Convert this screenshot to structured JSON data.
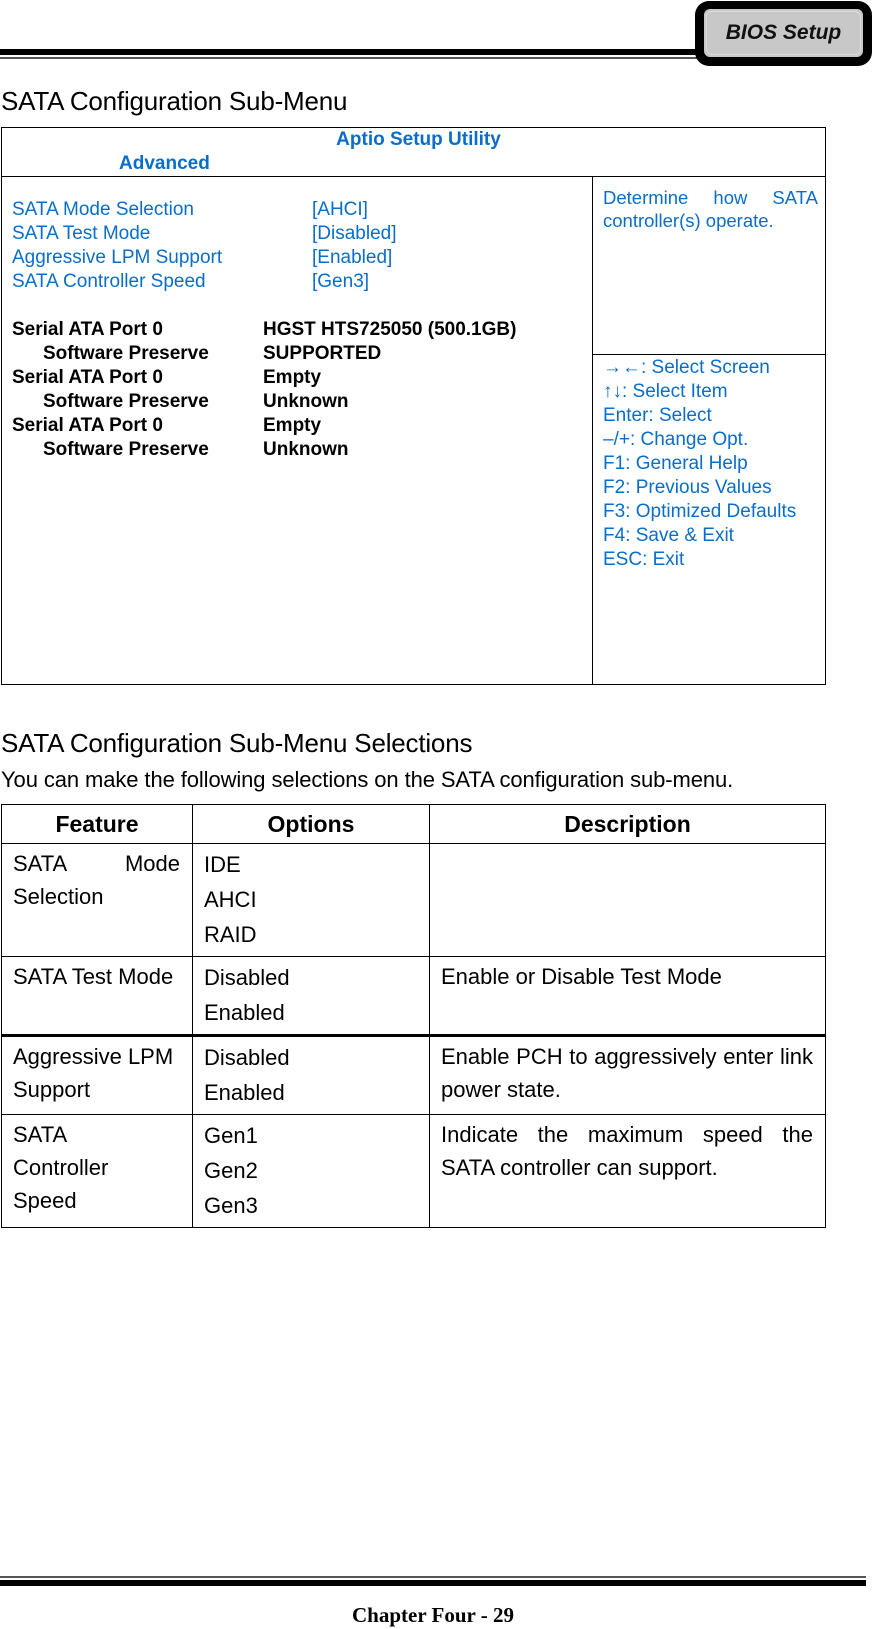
{
  "header": {
    "badge": "BIOS Setup"
  },
  "section1": {
    "title": "SATA Configuration Sub-Menu"
  },
  "bios": {
    "utility_title": "Aptio Setup Utility",
    "active_tab": "Advanced",
    "text_color": "#0a6ec8",
    "settings": [
      {
        "label": "SATA Mode Selection",
        "value": "[AHCI]"
      },
      {
        "label": "SATA Test Mode",
        "value": "[Disabled]"
      },
      {
        "label": "Aggressive LPM Support",
        "value": "[Enabled]"
      },
      {
        "label": "SATA Controller Speed",
        "value": "[Gen3]"
      }
    ],
    "ports": [
      {
        "label": "Serial ATA Port 0",
        "value": "HGST HTS725050 (500.1GB)",
        "sub_label": "Software Preserve",
        "sub_value": "SUPPORTED"
      },
      {
        "label": "Serial ATA Port 0",
        "value": "Empty",
        "sub_label": "Software Preserve",
        "sub_value": "Unknown"
      },
      {
        "label": "Serial ATA Port 0",
        "value": "Empty",
        "sub_label": "Software Preserve",
        "sub_value": "Unknown"
      }
    ],
    "help_text": "Determine how SATA controller(s) operate.",
    "key_help": [
      "→←: Select Screen",
      "↑↓: Select Item",
      "Enter: Select",
      "–/+: Change Opt.",
      "F1: General Help",
      "F2: Previous Values",
      "F3: Optimized Defaults",
      "F4: Save & Exit",
      "ESC: Exit"
    ]
  },
  "section2": {
    "title": "SATA Configuration Sub-Menu Selections",
    "intro": "You can make the following selections on the SATA configuration sub-menu.",
    "table": {
      "headers": [
        "Feature",
        "Options",
        "Description"
      ],
      "rows": [
        {
          "feature": "SATA Mode Selection",
          "options": [
            "IDE",
            "AHCI",
            "RAID"
          ],
          "description": ""
        },
        {
          "feature": "SATA Test Mode",
          "options": [
            "Disabled",
            "Enabled"
          ],
          "description": "Enable or Disable Test Mode"
        },
        {
          "feature": "Aggressive LPM Support",
          "options": [
            "Disabled",
            "Enabled"
          ],
          "description": "Enable PCH to aggressively enter link power state."
        },
        {
          "feature": "SATA Controller Speed",
          "options": [
            "Gen1",
            "Gen2",
            "Gen3"
          ],
          "description": "Indicate the maximum speed the SATA controller can support."
        }
      ]
    }
  },
  "footer": {
    "page_label": "Chapter Four - 29"
  }
}
